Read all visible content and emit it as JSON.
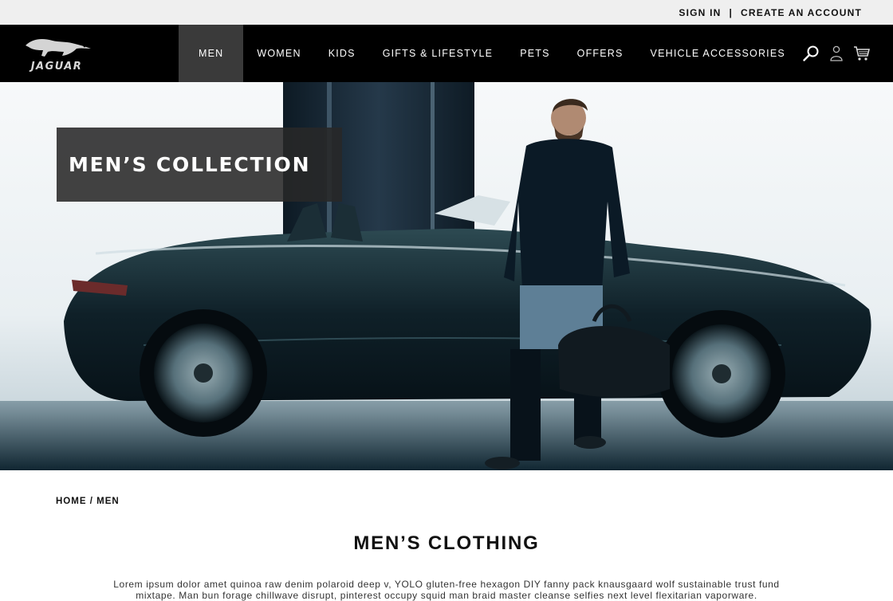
{
  "topbar": {
    "sign_in": "SIGN IN",
    "separator": "|",
    "create_account": "CREATE AN ACCOUNT"
  },
  "brand": {
    "logo_text": "JAGUAR"
  },
  "nav": {
    "items": [
      {
        "label": "MEN",
        "active": true
      },
      {
        "label": "WOMEN"
      },
      {
        "label": "KIDS"
      },
      {
        "label": "GIFTS & LIFESTYLE"
      },
      {
        "label": "PETS"
      },
      {
        "label": "OFFERS"
      },
      {
        "label": "VEHICLE ACCESSORIES"
      }
    ],
    "icons": [
      "search-icon",
      "account-icon",
      "cart-icon"
    ]
  },
  "hero": {
    "title": "MEN’S COLLECTION"
  },
  "breadcrumb": {
    "home": "HOME",
    "separator": "/",
    "current": "MEN"
  },
  "page": {
    "title": "MEN’S CLOTHING",
    "intro": "Lorem ipsum dolor amet quinoa raw denim polaroid deep v, YOLO gluten-free hexagon DIY fanny pack knausgaard wolf sustainable trust fund mixtape. Man bun forage chillwave disrupt, pinterest occupy squid man braid master cleanse selfies next level flexitarian vaporware."
  },
  "colors": {
    "nav_bg": "#000000",
    "nav_active": "#3a3a3a",
    "topbar_bg": "#efefef",
    "hero_box": "#282828"
  }
}
